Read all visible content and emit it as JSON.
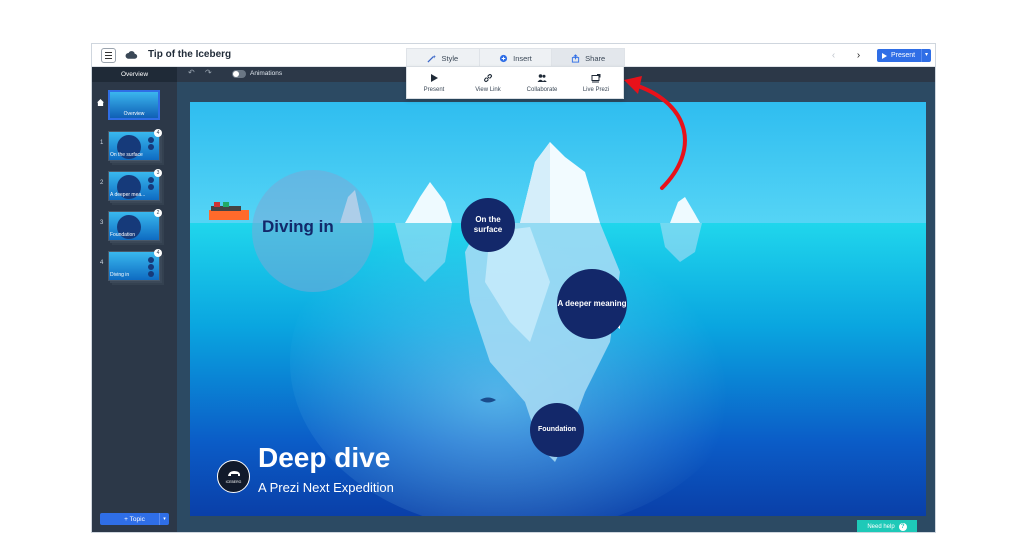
{
  "header": {
    "title": "Tip of the Iceberg",
    "tabs": [
      {
        "label": "Style",
        "icon": "wand-icon"
      },
      {
        "label": "Insert",
        "icon": "plus-circle-icon"
      },
      {
        "label": "Share",
        "icon": "share-icon"
      }
    ],
    "present_label": "Present"
  },
  "share_menu": {
    "items": [
      {
        "label": "Present",
        "icon": "play-icon"
      },
      {
        "label": "View Link",
        "icon": "link-icon"
      },
      {
        "label": "Collaborate",
        "icon": "people-icon"
      },
      {
        "label": "Live Prezi",
        "icon": "live-prezi-icon"
      }
    ]
  },
  "subbar": {
    "overview_label": "Overview",
    "animations_label": "Animations"
  },
  "sidebar": {
    "overview_caption": "Overview",
    "slides": [
      {
        "number": "1",
        "caption": "On the surface",
        "badge": "4"
      },
      {
        "number": "2",
        "caption": "A deeper mea...",
        "badge": "3"
      },
      {
        "number": "3",
        "caption": "Foundation",
        "badge": "2"
      },
      {
        "number": "4",
        "caption": "Diving in",
        "badge": "4"
      }
    ],
    "topic_button": "+ Topic"
  },
  "stage": {
    "diving_in": "Diving in",
    "topics": [
      "On the surface",
      "A deeper meaning",
      "Foundation"
    ],
    "title": "Deep dive",
    "subtitle": "A Prezi Next Expedition",
    "logo_text": "ICEBERG"
  },
  "help_button": "Need help",
  "colors": {
    "accent_blue": "#2f6ee6",
    "topic_navy": "#13286a",
    "help_teal": "#1ec9b8",
    "arrow_red": "#e8111a"
  }
}
